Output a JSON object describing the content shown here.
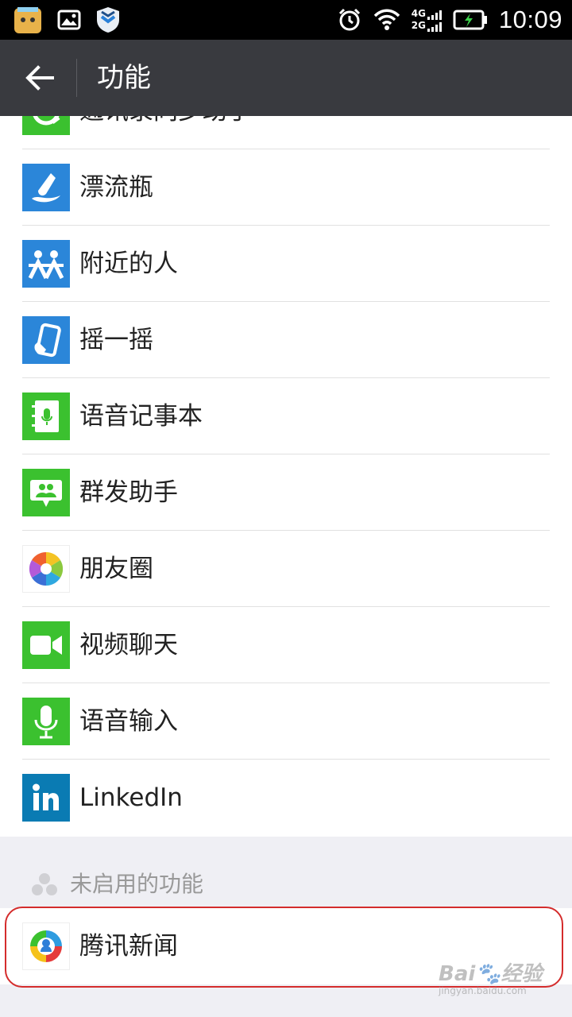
{
  "status_bar": {
    "time": "10:09",
    "net_top": "4G",
    "net_bottom": "2G"
  },
  "action_bar": {
    "title": "功能"
  },
  "features": [
    {
      "label": "通讯录同步助手",
      "icon": "contacts-sync-icon",
      "color": "#3bc12f"
    },
    {
      "label": "漂流瓶",
      "icon": "drift-bottle-icon",
      "color": "#2b86d9"
    },
    {
      "label": "附近的人",
      "icon": "people-nearby-icon",
      "color": "#2b86d9"
    },
    {
      "label": "摇一摇",
      "icon": "shake-icon",
      "color": "#2b86d9"
    },
    {
      "label": "语音记事本",
      "icon": "voice-notepad-icon",
      "color": "#3bc12f"
    },
    {
      "label": "群发助手",
      "icon": "broadcast-icon",
      "color": "#3bc12f"
    },
    {
      "label": "朋友圈",
      "icon": "moments-icon",
      "color": "#ffffff"
    },
    {
      "label": "视频聊天",
      "icon": "video-chat-icon",
      "color": "#3bc12f"
    },
    {
      "label": "语音输入",
      "icon": "voice-input-icon",
      "color": "#3bc12f"
    },
    {
      "label": "LinkedIn",
      "icon": "linkedin-icon",
      "color": "#0a7bb3"
    }
  ],
  "disabled_section": {
    "title": "未启用的功能",
    "items": [
      {
        "label": "腾讯新闻",
        "icon": "tencent-news-icon"
      }
    ]
  },
  "watermark": {
    "brand": "Bai",
    "brand_suffix": "经验",
    "url": "jingyan.baidu.com"
  }
}
